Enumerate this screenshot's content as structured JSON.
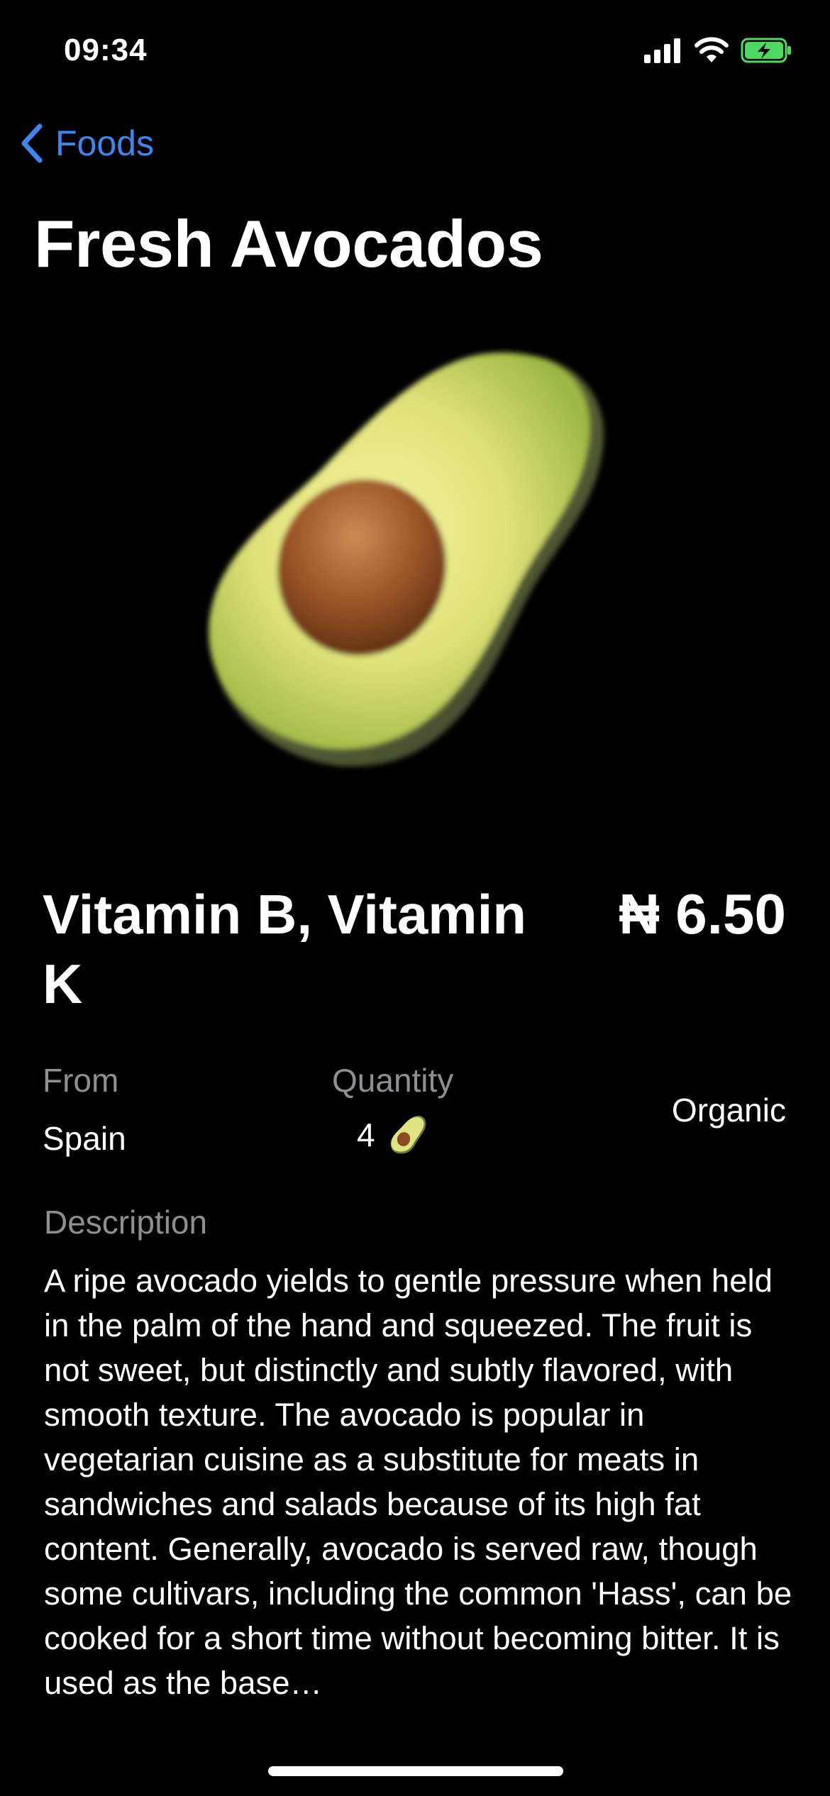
{
  "status_bar": {
    "time": "09:34",
    "icons": [
      "cellular-signal-icon",
      "wifi-icon",
      "battery-charging-icon"
    ],
    "battery_color": "#4cd964"
  },
  "nav": {
    "back_label": "Foods",
    "accent_color": "#3c87f0"
  },
  "page": {
    "title": "Fresh Avocados",
    "hero_icon": "avocado-icon"
  },
  "product": {
    "nutrients": "Vitamin B, Vitamin K",
    "price": "₦ 6.50",
    "from_label": "From",
    "from_value": "Spain",
    "quantity_label": "Quantity",
    "quantity_value": "4",
    "quantity_icon": "avocado-icon",
    "tag": "Organic",
    "description_label": "Description",
    "description": "A ripe avocado yields to gentle pressure when held in the palm of the hand and squeezed. The fruit is not sweet, but distinctly and subtly flavored, with smooth texture. The avocado is popular in vegetarian cuisine as a substitute for meats in sandwiches and salads because of its high fat content. Generally, avocado is served raw, though some cultivars, including the common 'Hass', can be cooked for a short time without becoming bitter. It is used as the base…"
  }
}
